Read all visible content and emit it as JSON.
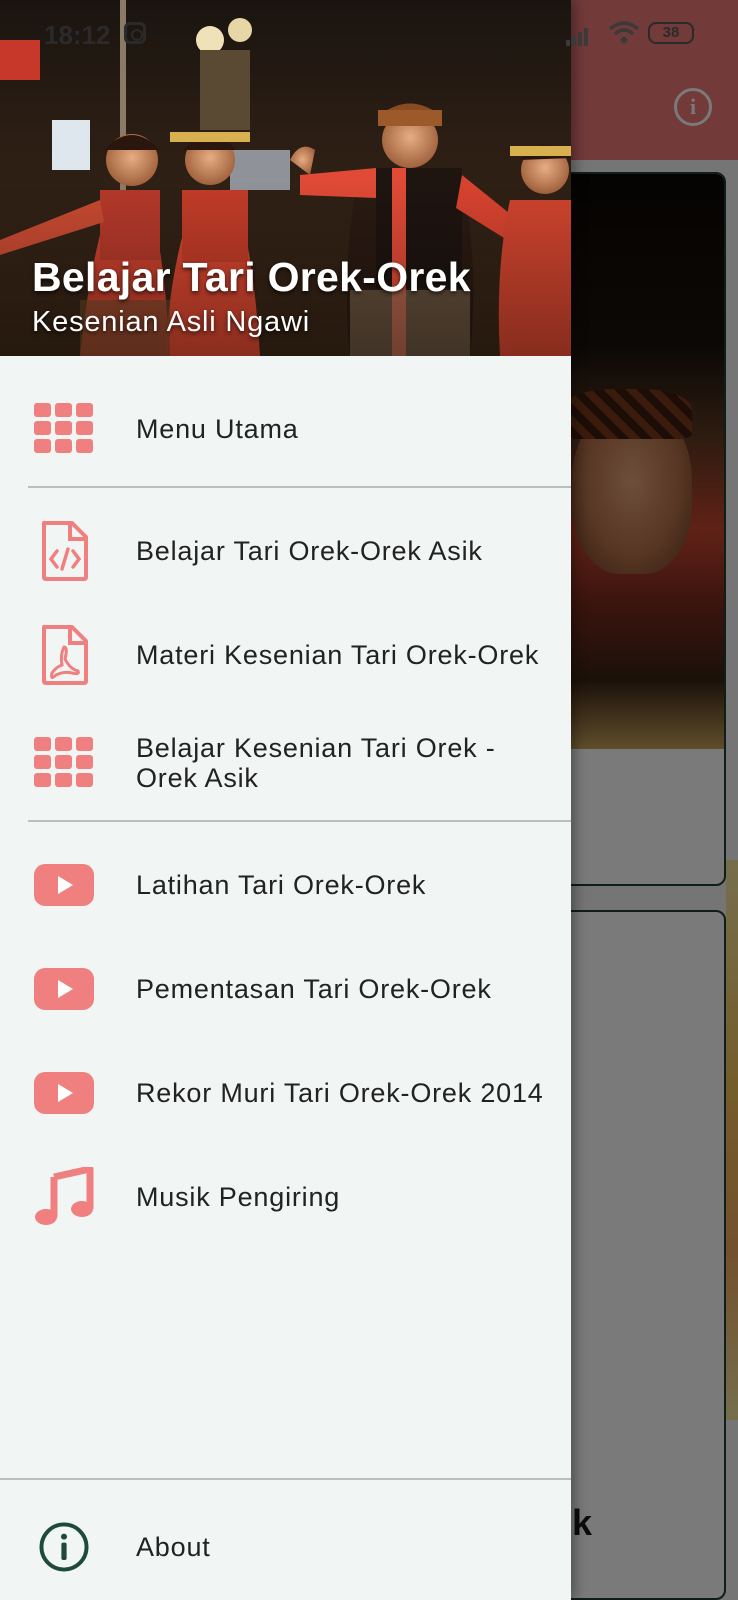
{
  "status_bar": {
    "time": "18:12",
    "battery": "38"
  },
  "background_app": {
    "info_icon": "info-icon",
    "card_text_fragment": "k"
  },
  "drawer": {
    "header": {
      "title": "Belajar Tari Orek-Orek",
      "subtitle": "Kesenian Asli Ngawi"
    },
    "items": [
      {
        "label": "Menu Utama",
        "icon": "grid-icon"
      },
      {
        "label": "Belajar Tari Orek-Orek Asik",
        "icon": "code-file-icon"
      },
      {
        "label": "Materi Kesenian Tari Orek-Orek",
        "icon": "pdf-file-icon"
      },
      {
        "label": "Belajar Kesenian Tari Orek -Orek Asik",
        "icon": "grid-icon"
      },
      {
        "label": "Latihan Tari Orek-Orek",
        "icon": "youtube-play-icon"
      },
      {
        "label": "Pementasan Tari Orek-Orek",
        "icon": "youtube-play-icon"
      },
      {
        "label": "Rekor Muri Tari Orek-Orek 2014",
        "icon": "youtube-play-icon"
      },
      {
        "label": "Musik Pengiring",
        "icon": "music-note-icon"
      }
    ],
    "footer": {
      "label": "About",
      "icon": "info-icon"
    }
  },
  "colors": {
    "accent": "#f07a7a",
    "icon_dark": "#1e4a3c",
    "drawer_bg": "#f1f5f3"
  }
}
